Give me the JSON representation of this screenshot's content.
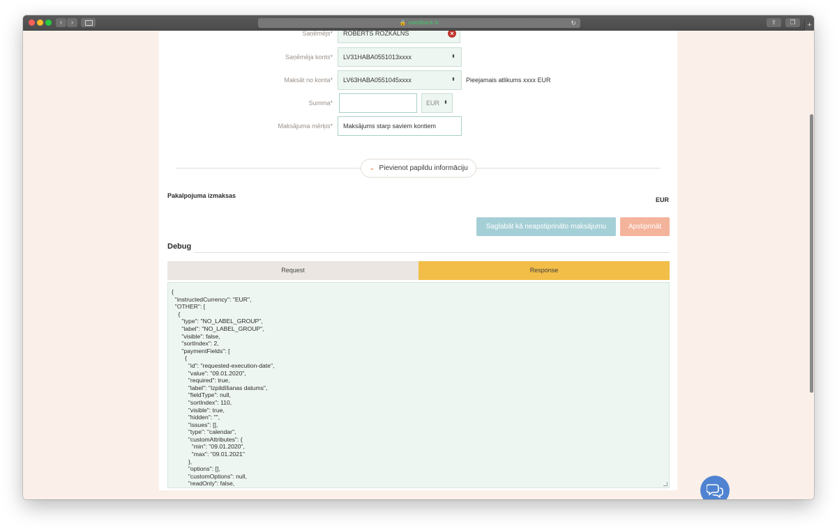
{
  "browser": {
    "url": "swedbank.lv",
    "back_icon": "chevron-left-icon",
    "forward_icon": "chevron-right-icon"
  },
  "form": {
    "recipient_label": "Saņēmējs*",
    "recipient_value": "ROBERTS ROZKALNS",
    "recipient_account_label": "Saņēmēja konts*",
    "recipient_account_value": "LV31HABA0551013xxxx",
    "pay_from_label": "Maksāt no konta*",
    "pay_from_value": "LV63HABA0551045xxxx",
    "available_balance": "Pieejamais atlikums xxxx EUR",
    "amount_label": "Summa*",
    "amount_value": "",
    "currency_value": "EUR",
    "purpose_label": "Maksājuma mērķis*",
    "purpose_value": "Maksājums starp saviem kontiem",
    "add_info_label": "Pievienot papildu informāciju"
  },
  "costs": {
    "label": "Pakalpojuma izmaksas",
    "value": "EUR"
  },
  "actions": {
    "save_draft_label": "Saglabāt kā neapstiprināto maksājumu",
    "confirm_label": "Apstiprināt"
  },
  "debug": {
    "title": "Debug",
    "tabs": {
      "request": "Request",
      "response": "Response"
    },
    "active_tab": "response",
    "code_lines": [
      "{",
      "  \"instructedCurrency\": \"EUR\",",
      "  \"OTHER\": [",
      "    {",
      "      \"type\": \"NO_LABEL_GROUP\",",
      "      \"label\": \"NO_LABEL_GROUP\",",
      "      \"visible\": false,",
      "      \"sortIndex\": 2,",
      "      \"paymentFields\": [",
      "        {",
      "          \"id\": \"requested-execution-date\",",
      "          \"value\": \"09.01.2020\",",
      "          \"required\": true,",
      "          \"label\": \"Izpildīšanas datums\",",
      "          \"fieldType\": null,",
      "          \"sortIndex\": 110,",
      "          \"visible\": true,",
      "          \"hidden\": \"\",",
      "          \"issues\": [],",
      "          \"type\": \"calendar\",",
      "          \"customAttributes\": {",
      "            \"min\": \"09.01.2020\",",
      "            \"max\": \"09.01.2021\"",
      "          },",
      "          \"options\": [],",
      "          \"customOptions\": null,",
      "          \"readOnly\": false,"
    ]
  },
  "colors": {
    "accent_orange": "#e07a3c",
    "tab_active": "#f2be48",
    "save_button": "#a5cfd6",
    "confirm_button": "#f4b39b",
    "chat_button": "#4f83d1"
  }
}
